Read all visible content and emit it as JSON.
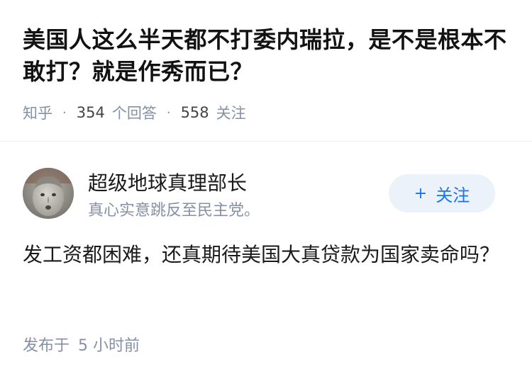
{
  "question": {
    "title": "美国人这么半天都不打委内瑞拉，是不是根本不敢打？就是作秀而已？",
    "source": "知乎",
    "answer_count": "354",
    "answer_count_label": "个回答",
    "follower_count": "558",
    "follower_count_label": "关注",
    "separator": "·"
  },
  "author": {
    "name": "超级地球真理部长",
    "bio": "真心实意跳反至民主党。",
    "avatar_icon": "avatar-icon",
    "follow_icon": "+",
    "follow_label": "关注"
  },
  "answer": {
    "content": "发工资都困难，还真期待美国大真贷款为国家卖命吗？",
    "published_prefix": "发布于",
    "published_time": "5 小时前"
  },
  "colors": {
    "accent": "#1772f6",
    "follow_bg": "#ebf2fa",
    "meta": "#8590a6"
  }
}
